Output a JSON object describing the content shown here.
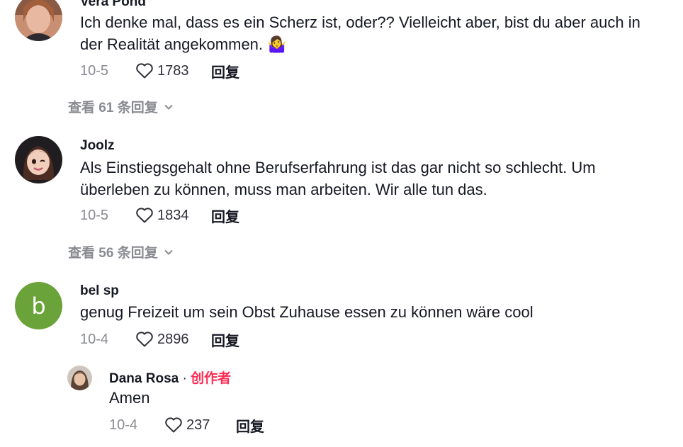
{
  "comments": [
    {
      "username": "Vera Pond",
      "text_line1": "Ich denke mal, dass es ein Scherz ist, oder?? Vielleicht aber, bist du aber auch in",
      "text_line2": "der Realität angekommen. 🤷‍♀️",
      "date": "10-5",
      "likes": "1783",
      "reply_label": "回复",
      "view_replies": "查看 61 条回复"
    },
    {
      "username": "Joolz",
      "text_line1": "Als Einstiegsgehalt ohne Berufserfahrung ist das gar nicht so schlecht. Um",
      "text_line2": "überleben zu können, muss man arbeiten. Wir alle tun das.",
      "date": "10-5",
      "likes": "1834",
      "reply_label": "回复",
      "view_replies": "查看 56 条回复"
    },
    {
      "username": "bel sp",
      "avatar_letter": "b",
      "text_line1": "genug Freizeit um sein Obst Zuhause essen zu können wäre cool",
      "date": "10-4",
      "likes": "2896",
      "reply_label": "回复"
    }
  ],
  "reply": {
    "username": "Dana Rosa",
    "separator": "·",
    "creator_label": "创作者",
    "text": "Amen",
    "date": "10-4",
    "likes": "237",
    "reply_label": "回复"
  },
  "colors": {
    "creator_accent": "#fe2c55",
    "muted_text": "#8a8b91",
    "letter_avatar_bg": "#6aa339"
  }
}
